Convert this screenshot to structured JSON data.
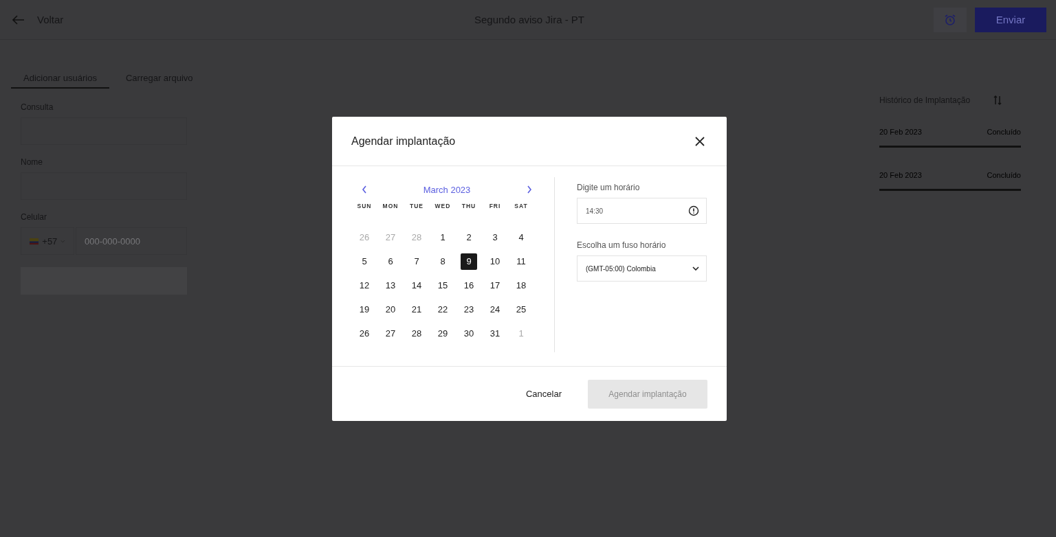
{
  "header": {
    "back_label": "Voltar",
    "title": "Segundo aviso Jira - PT",
    "send_button": "Enviar"
  },
  "tabs": [
    {
      "label": "Adicionar usuários",
      "selected": true
    },
    {
      "label": "Carregar arquivo",
      "selected": false
    }
  ],
  "form": {
    "fields": [
      {
        "label": "Consulta",
        "kind": "text"
      },
      {
        "label": "Nome",
        "kind": "text"
      },
      {
        "label": "Celular",
        "kind": "phone",
        "country_code": "+57",
        "placeholder": "000-000-0000"
      }
    ]
  },
  "history": {
    "title": "Histórico de Implantação",
    "entries": [
      {
        "date": "20 Feb 2023",
        "status": "Concluído"
      },
      {
        "date": "20 Feb 2023",
        "status": "Concluído"
      }
    ]
  },
  "dialog": {
    "title": "Agendar implantação",
    "calendar": {
      "month": "March 2023",
      "weekdays": [
        "SUN",
        "MON",
        "TUE",
        "WED",
        "THU",
        "FRI",
        "SAT"
      ],
      "days": [
        {
          "label": "26",
          "muted": true,
          "selected": false
        },
        {
          "label": "27",
          "muted": true,
          "selected": false
        },
        {
          "label": "28",
          "muted": true,
          "selected": false
        },
        {
          "label": "1",
          "muted": false,
          "selected": false
        },
        {
          "label": "2",
          "muted": false,
          "selected": false
        },
        {
          "label": "3",
          "muted": false,
          "selected": false
        },
        {
          "label": "4",
          "muted": false,
          "selected": false
        },
        {
          "label": "5",
          "muted": false,
          "selected": false
        },
        {
          "label": "6",
          "muted": false,
          "selected": false
        },
        {
          "label": "7",
          "muted": false,
          "selected": false
        },
        {
          "label": "8",
          "muted": false,
          "selected": false
        },
        {
          "label": "9",
          "muted": false,
          "selected": true
        },
        {
          "label": "10",
          "muted": false,
          "selected": false
        },
        {
          "label": "11",
          "muted": false,
          "selected": false
        },
        {
          "label": "12",
          "muted": false,
          "selected": false
        },
        {
          "label": "13",
          "muted": false,
          "selected": false
        },
        {
          "label": "14",
          "muted": false,
          "selected": false
        },
        {
          "label": "15",
          "muted": false,
          "selected": false
        },
        {
          "label": "16",
          "muted": false,
          "selected": false
        },
        {
          "label": "17",
          "muted": false,
          "selected": false
        },
        {
          "label": "18",
          "muted": false,
          "selected": false
        },
        {
          "label": "19",
          "muted": false,
          "selected": false
        },
        {
          "label": "20",
          "muted": false,
          "selected": false
        },
        {
          "label": "21",
          "muted": false,
          "selected": false
        },
        {
          "label": "22",
          "muted": false,
          "selected": false
        },
        {
          "label": "23",
          "muted": false,
          "selected": false
        },
        {
          "label": "24",
          "muted": false,
          "selected": false
        },
        {
          "label": "25",
          "muted": false,
          "selected": false
        },
        {
          "label": "26",
          "muted": false,
          "selected": false
        },
        {
          "label": "27",
          "muted": false,
          "selected": false
        },
        {
          "label": "28",
          "muted": false,
          "selected": false
        },
        {
          "label": "29",
          "muted": false,
          "selected": false
        },
        {
          "label": "30",
          "muted": false,
          "selected": false
        },
        {
          "label": "31",
          "muted": false,
          "selected": false
        },
        {
          "label": "1",
          "muted": true,
          "selected": false
        }
      ]
    },
    "time_label": "Digite um horário",
    "time_value": "14:30",
    "timezone_label": "Escolha um fuso horário",
    "timezone_value": "(GMT-05:00) Colombia",
    "cancel_button": "Cancelar",
    "confirm_button": {
      "label": "Agendar implantação",
      "disabled": true
    }
  }
}
